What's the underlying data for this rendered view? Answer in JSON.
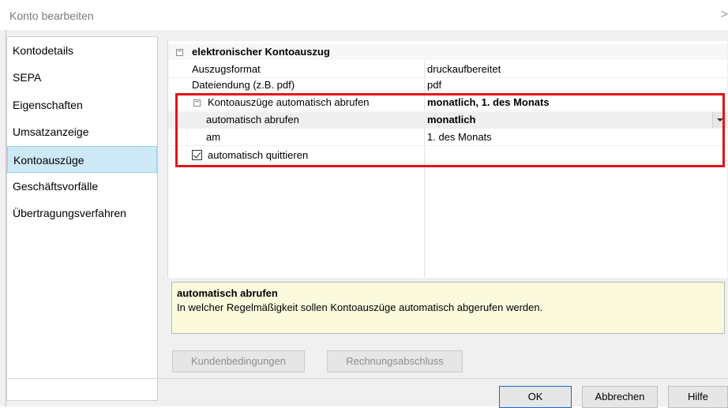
{
  "window": {
    "title": "Konto bearbeiten",
    "close_glyph": ">"
  },
  "nav": {
    "items": [
      "Kontodetails",
      "SEPA",
      "Eigenschaften",
      "Umsatzanzeige",
      "Kontoauszüge",
      "Geschäftsvorfälle",
      "Übertragungsverfahren"
    ],
    "selected": "Kontoauszüge"
  },
  "grid": {
    "category": "elektronischer Kontoauszug",
    "rows": [
      {
        "key": "Auszugsformat",
        "value": "druckaufbereitet"
      },
      {
        "key": "Dateiendung (z.B. pdf)",
        "value": "pdf"
      }
    ],
    "group": {
      "key": "Kontoauszüge automatisch abrufen",
      "value": "monatlich, 1. des Monats"
    },
    "sub_rows": [
      {
        "key": "automatisch abrufen",
        "value": "monatlich"
      },
      {
        "key": "am",
        "value": "1. des Monats"
      }
    ],
    "checkbox": {
      "label": "automatisch quittieren",
      "checked": true
    }
  },
  "help": {
    "title": "automatisch abrufen",
    "description": "In welcher Regelmäßigkeit sollen Kontoauszüge automatisch abgerufen werden."
  },
  "buttons": {
    "kundenbedingungen": "Kundenbedingungen",
    "rechnungsabschluss": "Rechnungsabschluss",
    "ok": "OK",
    "abbrechen": "Abbrechen",
    "hilfe": "Hilfe"
  },
  "colors": {
    "highlight": "#e0141c",
    "selection": "#cde8f7",
    "help_bg": "#fcfadd"
  }
}
